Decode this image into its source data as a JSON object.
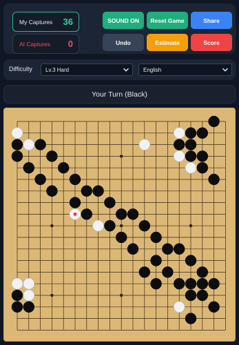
{
  "scores": {
    "my_label": "My Captures",
    "my_value": "36",
    "ai_label": "AI Captures",
    "ai_value": "0"
  },
  "buttons": {
    "sound": "SOUND ON",
    "reset": "Reset Game",
    "share": "Share",
    "undo": "Undo",
    "estimate": "Estimate",
    "score": "Score"
  },
  "settings": {
    "difficulty_label": "Difficulty",
    "difficulty_value": "Lv.3 Hard",
    "language_value": "English"
  },
  "status": "Your Turn (Black)",
  "colors": {
    "background": "#0f1724",
    "panel": "#1c2535",
    "board": "#dcb877",
    "accent_green": "#1fae7e",
    "accent_blue": "#3b82f6",
    "accent_orange": "#f59e0b",
    "accent_red": "#ef4444",
    "last_move_marker": "#e53935"
  },
  "board": {
    "size": 19,
    "last_move": [
      5,
      8
    ],
    "black": [
      [
        17,
        0
      ],
      [
        15,
        1
      ],
      [
        16,
        1
      ],
      [
        0,
        2
      ],
      [
        2,
        2
      ],
      [
        14,
        2
      ],
      [
        15,
        2
      ],
      [
        0,
        3
      ],
      [
        3,
        3
      ],
      [
        15,
        3
      ],
      [
        16,
        3
      ],
      [
        1,
        4
      ],
      [
        4,
        4
      ],
      [
        16,
        4
      ],
      [
        2,
        5
      ],
      [
        5,
        5
      ],
      [
        17,
        5
      ],
      [
        3,
        6
      ],
      [
        6,
        6
      ],
      [
        7,
        6
      ],
      [
        5,
        7
      ],
      [
        8,
        7
      ],
      [
        6,
        8
      ],
      [
        9,
        8
      ],
      [
        10,
        8
      ],
      [
        8,
        9
      ],
      [
        11,
        9
      ],
      [
        9,
        10
      ],
      [
        12,
        10
      ],
      [
        10,
        11
      ],
      [
        13,
        11
      ],
      [
        14,
        11
      ],
      [
        12,
        12
      ],
      [
        15,
        12
      ],
      [
        11,
        13
      ],
      [
        13,
        13
      ],
      [
        16,
        13
      ],
      [
        12,
        14
      ],
      [
        14,
        14
      ],
      [
        15,
        14
      ],
      [
        16,
        14
      ],
      [
        17,
        14
      ],
      [
        0,
        15
      ],
      [
        15,
        15
      ],
      [
        16,
        15
      ],
      [
        0,
        16
      ],
      [
        1,
        16
      ],
      [
        14,
        16
      ],
      [
        17,
        16
      ],
      [
        15,
        17
      ]
    ],
    "white": [
      [
        0,
        1
      ],
      [
        14,
        1
      ],
      [
        1,
        2
      ],
      [
        11,
        2
      ],
      [
        14,
        3
      ],
      [
        15,
        4
      ],
      [
        7,
        9
      ],
      [
        0,
        14
      ],
      [
        1,
        14
      ],
      [
        1,
        15
      ],
      [
        14,
        16
      ]
    ]
  }
}
